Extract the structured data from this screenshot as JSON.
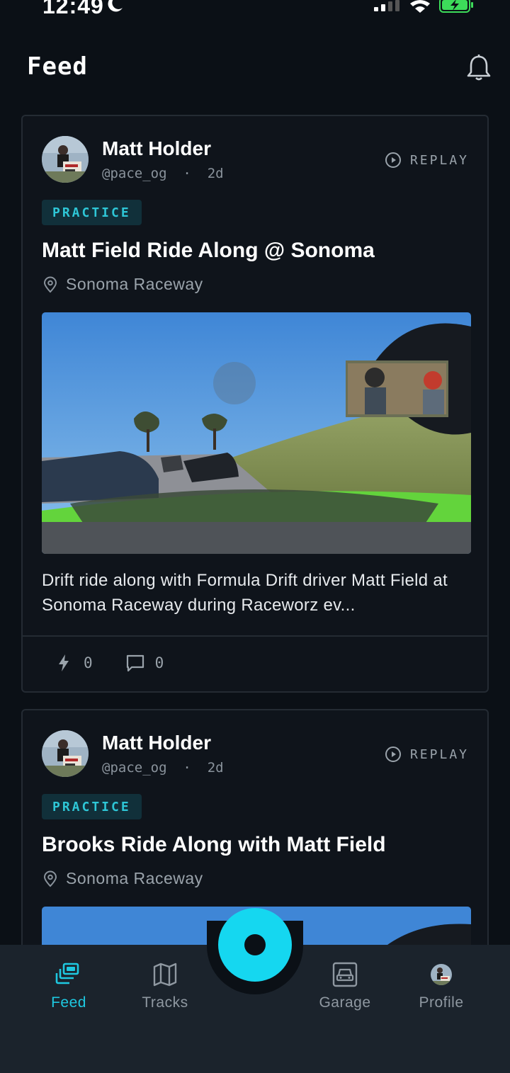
{
  "status_bar": {
    "time": "12:49"
  },
  "header": {
    "title": "Feed"
  },
  "posts": [
    {
      "author": "Matt Holder",
      "handle": "@pace_og",
      "age": "2d",
      "replay_label": "REPLAY",
      "badge": "PRACTICE",
      "title": "Matt Field Ride Along @ Sonoma",
      "location": "Sonoma Raceway",
      "description": "Drift ride along with Formula Drift driver Matt Field at Sonoma Raceway during Raceworz ev...",
      "likes": "0",
      "comments": "0"
    },
    {
      "author": "Matt Holder",
      "handle": "@pace_og",
      "age": "2d",
      "replay_label": "REPLAY",
      "badge": "PRACTICE",
      "title": "Brooks Ride Along with Matt Field",
      "location": "Sonoma Raceway"
    }
  ],
  "bottom_nav": {
    "items": [
      {
        "label": "Feed",
        "icon": "feed-icon",
        "active": true
      },
      {
        "label": "Tracks",
        "icon": "map-icon",
        "active": false
      },
      {
        "label": "Garage",
        "icon": "garage-icon",
        "active": false
      },
      {
        "label": "Profile",
        "icon": "profile-avatar",
        "active": false
      }
    ],
    "record_icon": "record-icon"
  },
  "colors": {
    "accent": "#1ec8e0",
    "background": "#0b1016",
    "card": "#0f141b",
    "badge_bg": "#11303a"
  }
}
